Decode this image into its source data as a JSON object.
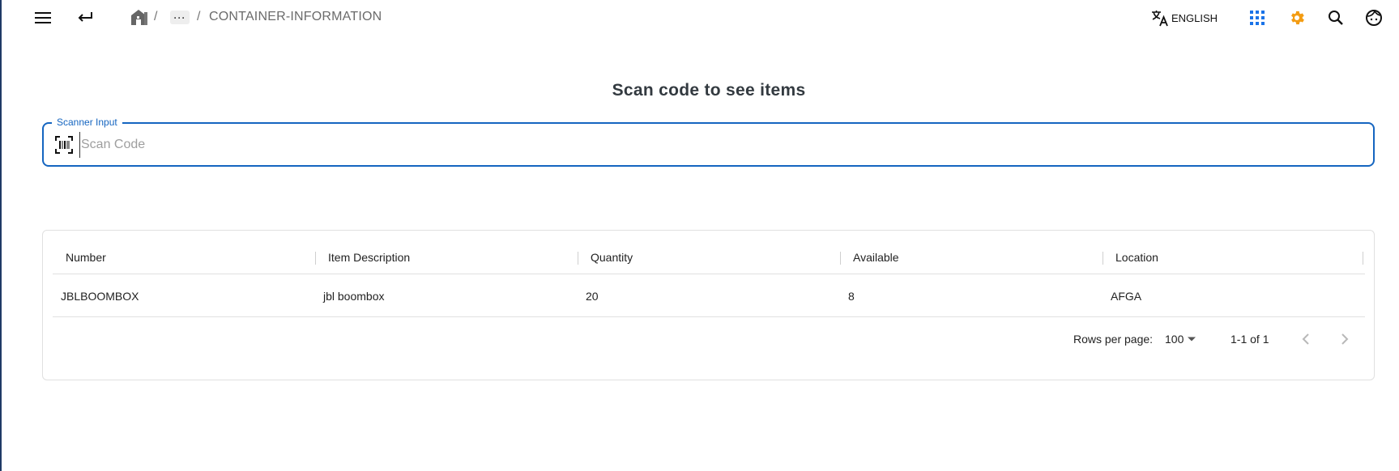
{
  "breadcrumb": {
    "separator": "/",
    "ellipsis": "···",
    "current": "CONTAINER-INFORMATION"
  },
  "header": {
    "language_label": "ENGLISH",
    "icons": [
      "menu-icon",
      "back-icon",
      "home-icon",
      "translate-icon",
      "apps-grid-icon",
      "gear-icon",
      "search-icon",
      "face-icon"
    ],
    "colors": {
      "apps": "#1a73e8",
      "gear": "#f39c12"
    }
  },
  "main": {
    "title": "Scan code to see items",
    "scanner": {
      "legend": "Scanner Input",
      "placeholder": "Scan Code",
      "value": "",
      "accent": "#1565c0"
    }
  },
  "table": {
    "columns": [
      "Number",
      "Item Description",
      "Quantity",
      "Available",
      "Location"
    ],
    "rows": [
      [
        "JBLBOOMBOX",
        "jbl boombox",
        "20",
        "8",
        "AFGA"
      ]
    ],
    "footer": {
      "rows_per_page_label": "Rows per page:",
      "rows_per_page_value": "100",
      "page_info": "1-1 of 1"
    }
  }
}
